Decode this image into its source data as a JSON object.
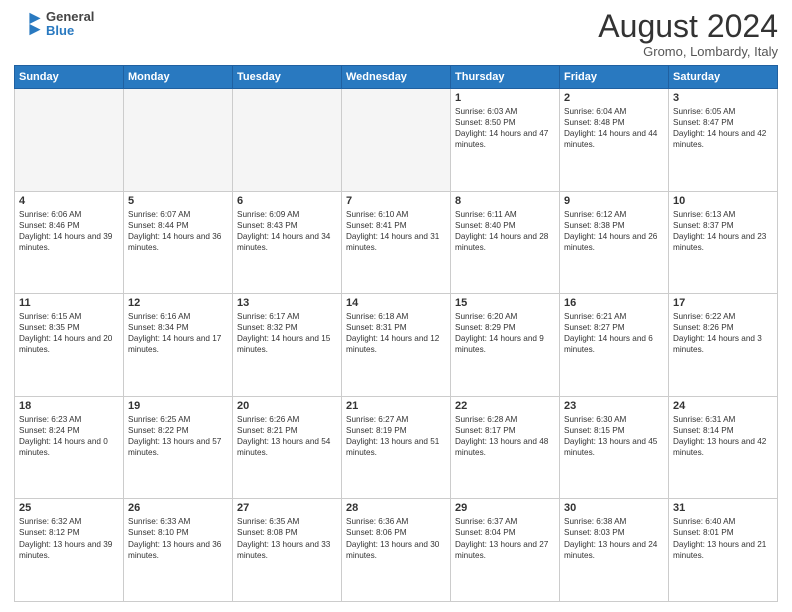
{
  "header": {
    "logo_line1": "General",
    "logo_line2": "Blue",
    "title": "August 2024",
    "subtitle": "Gromo, Lombardy, Italy"
  },
  "days_of_week": [
    "Sunday",
    "Monday",
    "Tuesday",
    "Wednesday",
    "Thursday",
    "Friday",
    "Saturday"
  ],
  "weeks": [
    [
      {
        "num": "",
        "info": ""
      },
      {
        "num": "",
        "info": ""
      },
      {
        "num": "",
        "info": ""
      },
      {
        "num": "",
        "info": ""
      },
      {
        "num": "1",
        "info": "Sunrise: 6:03 AM\nSunset: 8:50 PM\nDaylight: 14 hours and 47 minutes."
      },
      {
        "num": "2",
        "info": "Sunrise: 6:04 AM\nSunset: 8:48 PM\nDaylight: 14 hours and 44 minutes."
      },
      {
        "num": "3",
        "info": "Sunrise: 6:05 AM\nSunset: 8:47 PM\nDaylight: 14 hours and 42 minutes."
      }
    ],
    [
      {
        "num": "4",
        "info": "Sunrise: 6:06 AM\nSunset: 8:46 PM\nDaylight: 14 hours and 39 minutes."
      },
      {
        "num": "5",
        "info": "Sunrise: 6:07 AM\nSunset: 8:44 PM\nDaylight: 14 hours and 36 minutes."
      },
      {
        "num": "6",
        "info": "Sunrise: 6:09 AM\nSunset: 8:43 PM\nDaylight: 14 hours and 34 minutes."
      },
      {
        "num": "7",
        "info": "Sunrise: 6:10 AM\nSunset: 8:41 PM\nDaylight: 14 hours and 31 minutes."
      },
      {
        "num": "8",
        "info": "Sunrise: 6:11 AM\nSunset: 8:40 PM\nDaylight: 14 hours and 28 minutes."
      },
      {
        "num": "9",
        "info": "Sunrise: 6:12 AM\nSunset: 8:38 PM\nDaylight: 14 hours and 26 minutes."
      },
      {
        "num": "10",
        "info": "Sunrise: 6:13 AM\nSunset: 8:37 PM\nDaylight: 14 hours and 23 minutes."
      }
    ],
    [
      {
        "num": "11",
        "info": "Sunrise: 6:15 AM\nSunset: 8:35 PM\nDaylight: 14 hours and 20 minutes."
      },
      {
        "num": "12",
        "info": "Sunrise: 6:16 AM\nSunset: 8:34 PM\nDaylight: 14 hours and 17 minutes."
      },
      {
        "num": "13",
        "info": "Sunrise: 6:17 AM\nSunset: 8:32 PM\nDaylight: 14 hours and 15 minutes."
      },
      {
        "num": "14",
        "info": "Sunrise: 6:18 AM\nSunset: 8:31 PM\nDaylight: 14 hours and 12 minutes."
      },
      {
        "num": "15",
        "info": "Sunrise: 6:20 AM\nSunset: 8:29 PM\nDaylight: 14 hours and 9 minutes."
      },
      {
        "num": "16",
        "info": "Sunrise: 6:21 AM\nSunset: 8:27 PM\nDaylight: 14 hours and 6 minutes."
      },
      {
        "num": "17",
        "info": "Sunrise: 6:22 AM\nSunset: 8:26 PM\nDaylight: 14 hours and 3 minutes."
      }
    ],
    [
      {
        "num": "18",
        "info": "Sunrise: 6:23 AM\nSunset: 8:24 PM\nDaylight: 14 hours and 0 minutes."
      },
      {
        "num": "19",
        "info": "Sunrise: 6:25 AM\nSunset: 8:22 PM\nDaylight: 13 hours and 57 minutes."
      },
      {
        "num": "20",
        "info": "Sunrise: 6:26 AM\nSunset: 8:21 PM\nDaylight: 13 hours and 54 minutes."
      },
      {
        "num": "21",
        "info": "Sunrise: 6:27 AM\nSunset: 8:19 PM\nDaylight: 13 hours and 51 minutes."
      },
      {
        "num": "22",
        "info": "Sunrise: 6:28 AM\nSunset: 8:17 PM\nDaylight: 13 hours and 48 minutes."
      },
      {
        "num": "23",
        "info": "Sunrise: 6:30 AM\nSunset: 8:15 PM\nDaylight: 13 hours and 45 minutes."
      },
      {
        "num": "24",
        "info": "Sunrise: 6:31 AM\nSunset: 8:14 PM\nDaylight: 13 hours and 42 minutes."
      }
    ],
    [
      {
        "num": "25",
        "info": "Sunrise: 6:32 AM\nSunset: 8:12 PM\nDaylight: 13 hours and 39 minutes."
      },
      {
        "num": "26",
        "info": "Sunrise: 6:33 AM\nSunset: 8:10 PM\nDaylight: 13 hours and 36 minutes."
      },
      {
        "num": "27",
        "info": "Sunrise: 6:35 AM\nSunset: 8:08 PM\nDaylight: 13 hours and 33 minutes."
      },
      {
        "num": "28",
        "info": "Sunrise: 6:36 AM\nSunset: 8:06 PM\nDaylight: 13 hours and 30 minutes."
      },
      {
        "num": "29",
        "info": "Sunrise: 6:37 AM\nSunset: 8:04 PM\nDaylight: 13 hours and 27 minutes."
      },
      {
        "num": "30",
        "info": "Sunrise: 6:38 AM\nSunset: 8:03 PM\nDaylight: 13 hours and 24 minutes."
      },
      {
        "num": "31",
        "info": "Sunrise: 6:40 AM\nSunset: 8:01 PM\nDaylight: 13 hours and 21 minutes."
      }
    ]
  ]
}
